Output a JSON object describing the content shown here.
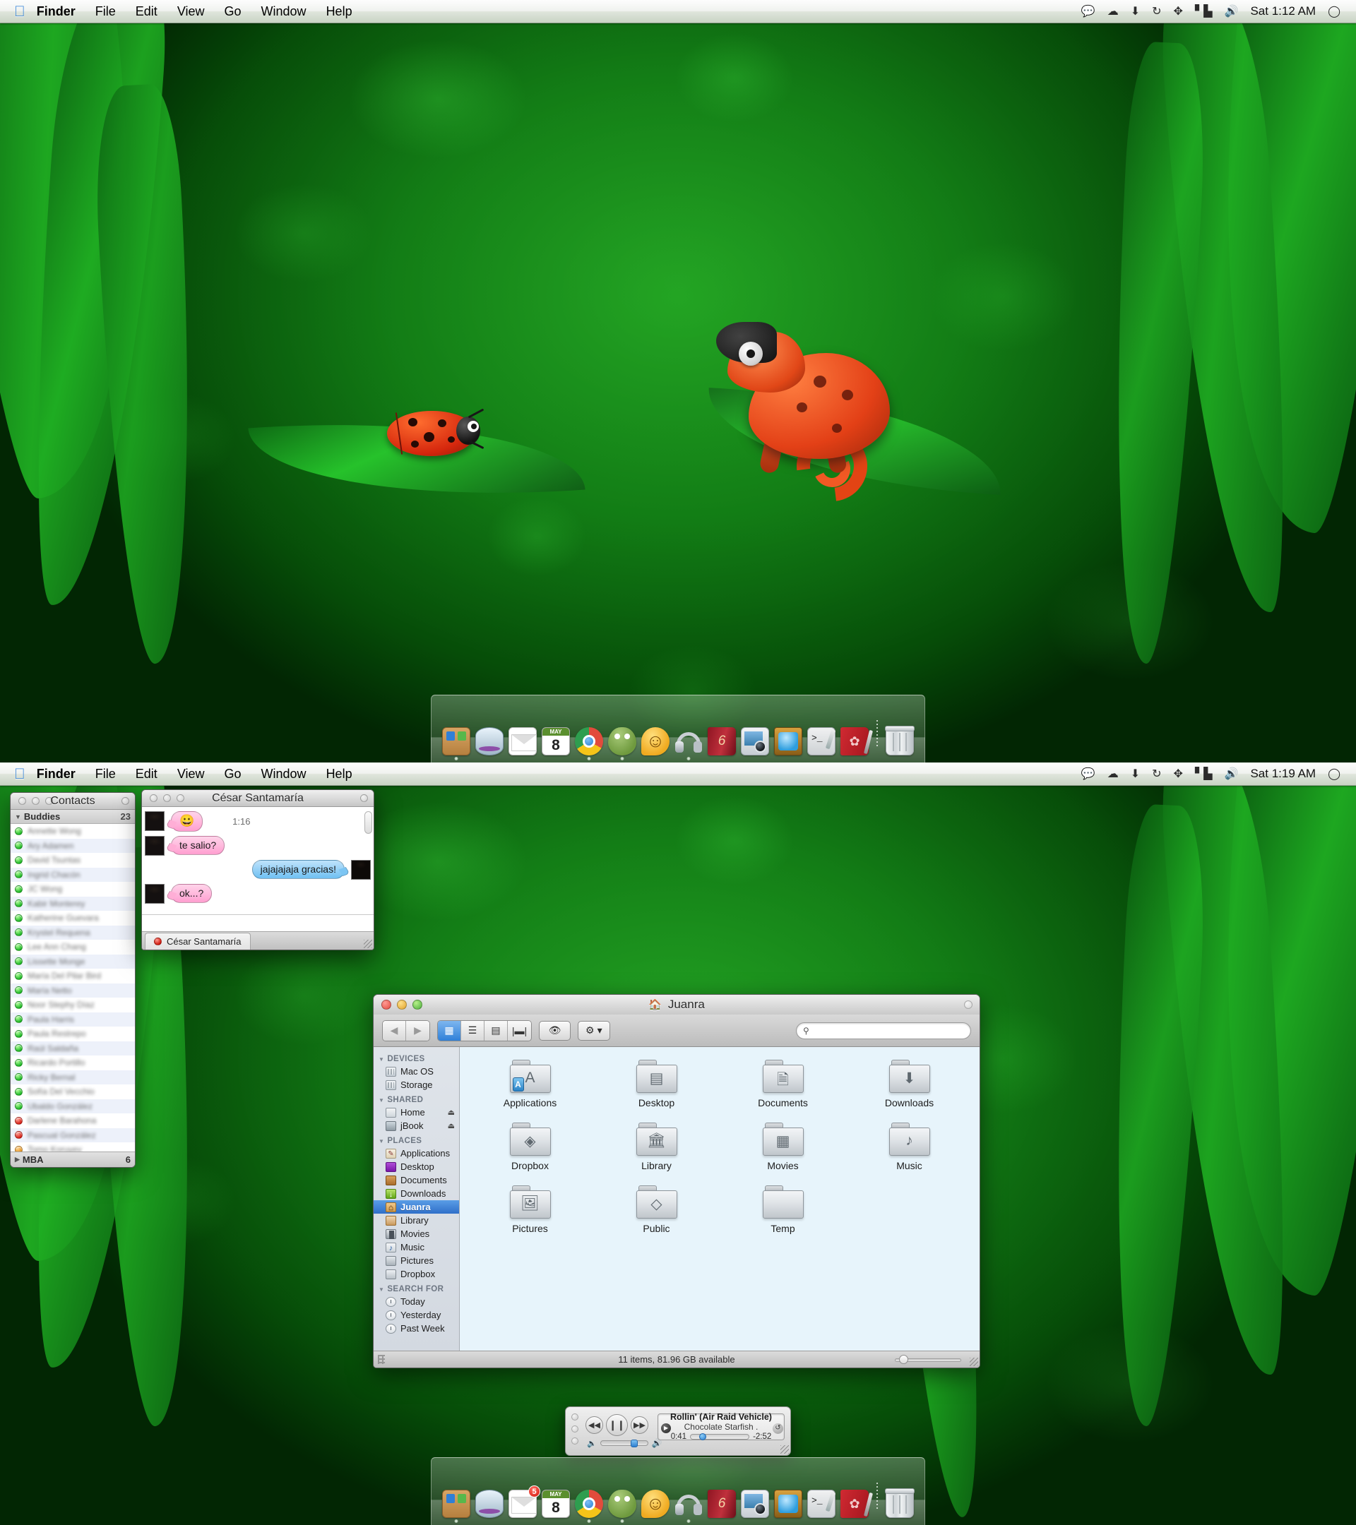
{
  "screens": [
    {
      "id": "top",
      "menubar": {
        "apple_icon": "apple-icon",
        "app": "Finder",
        "items": [
          "File",
          "Edit",
          "View",
          "Go",
          "Window",
          "Help"
        ],
        "active_item": "Go",
        "status_icons": [
          "chat-bubble-icon",
          "dropbox-icon",
          "download-arrow-icon",
          "sync-icon",
          "airdrop-icon",
          "wifi-signal-icon",
          "volume-icon"
        ],
        "clock": "Sat 1:12 AM",
        "spotlight_icon": "spotlight-search-icon"
      },
      "dock": {
        "items": [
          {
            "name": "finder",
            "label": "Finder",
            "icon": "finder-icon",
            "running": true,
            "badge": ""
          },
          {
            "name": "stacks",
            "label": "Stacks",
            "icon": "stack-icon",
            "running": false,
            "badge": ""
          },
          {
            "name": "mail",
            "label": "Mail",
            "icon": "mail-icon",
            "running": false,
            "badge": ""
          },
          {
            "name": "calendar",
            "label": "iCal",
            "icon": "calendar-icon",
            "running": false,
            "badge": "",
            "cal_month": "MAY",
            "cal_day": "8"
          },
          {
            "name": "chrome",
            "label": "Google Chrome",
            "icon": "chrome-icon",
            "running": true,
            "badge": ""
          },
          {
            "name": "adium",
            "label": "Adium",
            "icon": "adium-duck-icon",
            "running": true,
            "badge": ""
          },
          {
            "name": "messages",
            "label": "Messages",
            "icon": "messages-smiley-icon",
            "running": false,
            "badge": ""
          },
          {
            "name": "itunes",
            "label": "iTunes",
            "icon": "headphones-icon",
            "running": true,
            "badge": ""
          },
          {
            "name": "dictionary",
            "label": "Dictionary",
            "icon": "red-book-icon",
            "running": false,
            "badge": ""
          },
          {
            "name": "iphoto",
            "label": "iPhoto",
            "icon": "iphoto-camera-icon",
            "running": false,
            "badge": ""
          },
          {
            "name": "quicktime",
            "label": "QuickTime",
            "icon": "tv-icon",
            "running": false,
            "badge": ""
          },
          {
            "name": "terminal",
            "label": "Terminal",
            "icon": "terminal-icon",
            "running": false,
            "badge": ""
          },
          {
            "name": "notes",
            "label": "Notes",
            "icon": "red-notebook-icon",
            "running": false,
            "badge": ""
          }
        ],
        "trash": {
          "name": "trash",
          "label": "Trash",
          "icon": "trash-icon"
        }
      }
    },
    {
      "id": "bottom",
      "menubar": {
        "apple_icon": "apple-icon",
        "app": "Finder",
        "items": [
          "File",
          "Edit",
          "View",
          "Go",
          "Window",
          "Help"
        ],
        "active_item": "Go",
        "status_icons": [
          "chat-bubble-icon",
          "dropbox-icon",
          "download-arrow-icon",
          "sync-icon",
          "airdrop-icon",
          "wifi-signal-icon",
          "volume-icon"
        ],
        "clock": "Sat 1:19 AM",
        "spotlight_icon": "spotlight-search-icon"
      },
      "dock": {
        "items": [
          {
            "name": "finder",
            "label": "Finder",
            "icon": "finder-icon",
            "running": true,
            "badge": ""
          },
          {
            "name": "stacks",
            "label": "Stacks",
            "icon": "stack-icon",
            "running": false,
            "badge": ""
          },
          {
            "name": "mail",
            "label": "Mail",
            "icon": "mail-icon",
            "running": false,
            "badge": "5"
          },
          {
            "name": "calendar",
            "label": "iCal",
            "icon": "calendar-icon",
            "running": false,
            "badge": "",
            "cal_month": "MAY",
            "cal_day": "8"
          },
          {
            "name": "chrome",
            "label": "Google Chrome",
            "icon": "chrome-icon",
            "running": true,
            "badge": ""
          },
          {
            "name": "adium",
            "label": "Adium",
            "icon": "adium-duck-icon",
            "running": true,
            "badge": ""
          },
          {
            "name": "messages",
            "label": "Messages",
            "icon": "messages-smiley-icon",
            "running": false,
            "badge": ""
          },
          {
            "name": "itunes",
            "label": "iTunes",
            "icon": "headphones-icon",
            "running": true,
            "badge": ""
          },
          {
            "name": "dictionary",
            "label": "Dictionary",
            "icon": "red-book-icon",
            "running": false,
            "badge": ""
          },
          {
            "name": "iphoto",
            "label": "iPhoto",
            "icon": "iphoto-camera-icon",
            "running": false,
            "badge": ""
          },
          {
            "name": "quicktime",
            "label": "QuickTime",
            "icon": "tv-icon",
            "running": false,
            "badge": ""
          },
          {
            "name": "terminal",
            "label": "Terminal",
            "icon": "terminal-icon",
            "running": false,
            "badge": ""
          },
          {
            "name": "notes",
            "label": "Notes",
            "icon": "red-notebook-icon",
            "running": false,
            "badge": ""
          }
        ],
        "trash": {
          "name": "trash",
          "label": "Trash",
          "icon": "trash-icon"
        }
      }
    }
  ],
  "contacts_window": {
    "title": "Contacts",
    "group": {
      "label": "Buddies",
      "count": "23"
    },
    "footer_group": {
      "label": "MBA",
      "count": "6"
    },
    "buddies": [
      {
        "name": "Annette Wong",
        "status": "available"
      },
      {
        "name": "Ary Adamen",
        "status": "available"
      },
      {
        "name": "David Tsuntas",
        "status": "available"
      },
      {
        "name": "Ingrid Chacón",
        "status": "available"
      },
      {
        "name": "JC Wong",
        "status": "available"
      },
      {
        "name": "Kabir Monterey",
        "status": "available"
      },
      {
        "name": "Katherine Guevara",
        "status": "available"
      },
      {
        "name": "Krystel Requena",
        "status": "available"
      },
      {
        "name": "Lee Ann Chang",
        "status": "available"
      },
      {
        "name": "Lissette Monge",
        "status": "available"
      },
      {
        "name": "María Del Pilar Bird",
        "status": "available"
      },
      {
        "name": "María Netto",
        "status": "available"
      },
      {
        "name": "Noor Stephy Díaz",
        "status": "available"
      },
      {
        "name": "Paula Harris",
        "status": "available"
      },
      {
        "name": "Paula Restrepo",
        "status": "available"
      },
      {
        "name": "Raúl Saldaña",
        "status": "available"
      },
      {
        "name": "Ricardo Portillo",
        "status": "available"
      },
      {
        "name": "Ricky Bernal",
        "status": "available"
      },
      {
        "name": "Sofía Del Vecchio",
        "status": "available"
      },
      {
        "name": "Ubaldo González",
        "status": "available"
      },
      {
        "name": "Darlene Barahona",
        "status": "busy"
      },
      {
        "name": "Pascual González",
        "status": "busy"
      },
      {
        "name": "Tomo Koruyev",
        "status": "away"
      }
    ]
  },
  "chat_window": {
    "title": "César Santamaría",
    "messages": [
      {
        "from": "them",
        "type": "emoji",
        "text": "😀",
        "time": "1:16"
      },
      {
        "from": "them",
        "type": "text",
        "text": "te salio?",
        "time": ""
      },
      {
        "from": "me",
        "type": "text",
        "text": "jajajajaja gracias!",
        "time": ""
      },
      {
        "from": "them",
        "type": "text",
        "text": "ok...?",
        "time": ""
      }
    ],
    "input_value": "",
    "tab": {
      "label": "César Santamaría",
      "status": "busy"
    }
  },
  "finder_window": {
    "title": "Juanra",
    "title_icon": "home-folder-icon",
    "toolbar": {
      "back_icon": "chevron-left-icon",
      "forward_icon": "chevron-right-icon",
      "views": [
        {
          "name": "icon-view",
          "icon": "grid-view-icon",
          "selected": true
        },
        {
          "name": "list-view",
          "icon": "list-view-icon",
          "selected": false
        },
        {
          "name": "column-view",
          "icon": "column-view-icon",
          "selected": false
        },
        {
          "name": "coverflow-view",
          "icon": "coverflow-view-icon",
          "selected": false
        }
      ],
      "quicklook": {
        "name": "quick-look-button",
        "icon": "eye-icon"
      },
      "action": {
        "name": "action-menu-button",
        "icon": "gear-icon",
        "chevron": "▾"
      }
    },
    "search": {
      "value": "",
      "placeholder": "",
      "icon": "search-icon"
    },
    "sidebar": [
      {
        "header": "DEVICES",
        "items": [
          {
            "label": "Mac OS",
            "icon": "hard-disk-icon",
            "eject": false,
            "selected": false
          },
          {
            "label": "Storage",
            "icon": "hard-disk-icon",
            "eject": false,
            "selected": false
          }
        ]
      },
      {
        "header": "SHARED",
        "items": [
          {
            "label": "Home",
            "icon": "network-icon",
            "eject": true,
            "selected": false
          },
          {
            "label": "jBook",
            "icon": "laptop-icon",
            "eject": true,
            "selected": false
          }
        ]
      },
      {
        "header": "PLACES",
        "items": [
          {
            "label": "Applications",
            "icon": "applications-icon",
            "eject": false,
            "selected": false
          },
          {
            "label": "Desktop",
            "icon": "desktop-icon",
            "eject": false,
            "selected": false
          },
          {
            "label": "Documents",
            "icon": "documents-icon",
            "eject": false,
            "selected": false
          },
          {
            "label": "Downloads",
            "icon": "downloads-icon",
            "eject": false,
            "selected": false
          },
          {
            "label": "Juanra",
            "icon": "home-icon",
            "eject": false,
            "selected": true
          },
          {
            "label": "Library",
            "icon": "library-icon",
            "eject": false,
            "selected": false
          },
          {
            "label": "Movies",
            "icon": "movies-icon",
            "eject": false,
            "selected": false
          },
          {
            "label": "Music",
            "icon": "music-icon",
            "eject": false,
            "selected": false
          },
          {
            "label": "Pictures",
            "icon": "pictures-icon",
            "eject": false,
            "selected": false
          },
          {
            "label": "Dropbox",
            "icon": "dropbox-icon",
            "eject": false,
            "selected": false
          }
        ]
      },
      {
        "header": "SEARCH FOR",
        "items": [
          {
            "label": "Today",
            "icon": "clock-icon",
            "eject": false,
            "selected": false
          },
          {
            "label": "Yesterday",
            "icon": "clock-icon",
            "eject": false,
            "selected": false
          },
          {
            "label": "Past Week",
            "icon": "clock-icon",
            "eject": false,
            "selected": false
          }
        ]
      }
    ],
    "files": [
      {
        "label": "Applications",
        "icon": "applications-folder-icon",
        "glyph": "A",
        "badge": "A"
      },
      {
        "label": "Desktop",
        "icon": "desktop-folder-icon",
        "glyph": "▤",
        "badge": ""
      },
      {
        "label": "Documents",
        "icon": "documents-folder-icon",
        "glyph": "🗎",
        "badge": ""
      },
      {
        "label": "Downloads",
        "icon": "downloads-folder-icon",
        "glyph": "⬇",
        "badge": ""
      },
      {
        "label": "Dropbox",
        "icon": "dropbox-folder-icon",
        "glyph": "◈",
        "badge": ""
      },
      {
        "label": "Library",
        "icon": "library-folder-icon",
        "glyph": "🏛",
        "badge": ""
      },
      {
        "label": "Movies",
        "icon": "movies-folder-icon",
        "glyph": "▦",
        "badge": ""
      },
      {
        "label": "Music",
        "icon": "music-folder-icon",
        "glyph": "♪",
        "badge": ""
      },
      {
        "label": "Pictures",
        "icon": "pictures-folder-icon",
        "glyph": "🖼",
        "badge": ""
      },
      {
        "label": "Public",
        "icon": "public-folder-icon",
        "glyph": "◇",
        "badge": ""
      },
      {
        "label": "Temp",
        "icon": "plain-folder-icon",
        "glyph": "",
        "badge": ""
      }
    ],
    "status": "11 items, 81.96 GB available"
  },
  "itunes_mini": {
    "prev_icon": "rewind-icon",
    "play_icon": "pause-icon",
    "next_icon": "fast-forward-icon",
    "volume_low_icon": "volume-low-icon",
    "volume_high_icon": "volume-high-icon",
    "track_title": "Rollin' (Air Raid Vehicle)",
    "track_artist": "Chocolate Starfish .",
    "elapsed": "0:41",
    "remaining": "-2:52",
    "source_icon": "play-source-icon",
    "shuffle_icon": "repeat-icon"
  }
}
